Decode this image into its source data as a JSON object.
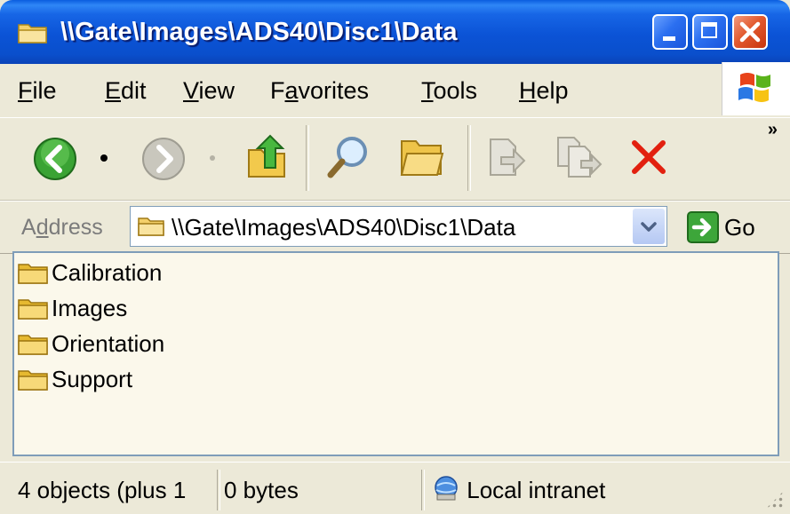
{
  "window": {
    "title": "\\\\Gate\\Images\\ADS40\\Disc1\\Data",
    "title_icon": "folder-icon"
  },
  "menu": {
    "items": [
      {
        "label": "File",
        "accel": "F",
        "rest": "ile"
      },
      {
        "label": "Edit",
        "accel": "E",
        "rest": "dit"
      },
      {
        "label": "View",
        "accel": "V",
        "rest": "iew"
      },
      {
        "label": "Favorites",
        "accel": "a",
        "pre": "F",
        "rest": "vorites"
      },
      {
        "label": "Tools",
        "accel": "T",
        "rest": "ools"
      },
      {
        "label": "Help",
        "accel": "H",
        "rest": "elp"
      }
    ]
  },
  "toolbar": {
    "buttons": [
      "back-icon",
      "forward-icon",
      "up-folder-icon",
      "search-icon",
      "folders-icon",
      "move-to-icon",
      "copy-to-icon",
      "delete-icon"
    ],
    "overflow": "»"
  },
  "address": {
    "label_pre": "A",
    "label_accel": "d",
    "label_rest": "dress",
    "value": "\\\\Gate\\Images\\ADS40\\Disc1\\Data",
    "go_label": "Go"
  },
  "files": [
    {
      "name": "Calibration",
      "icon": "folder-icon"
    },
    {
      "name": "Images",
      "icon": "folder-icon"
    },
    {
      "name": "Orientation",
      "icon": "folder-icon"
    },
    {
      "name": "Support",
      "icon": "folder-icon"
    }
  ],
  "status": {
    "objects": "4 objects (plus 1",
    "size": "0 bytes",
    "zone": "Local intranet",
    "zone_icon": "local-intranet-icon"
  },
  "colors": {
    "titlebar": "#0a53d6",
    "chrome": "#ece9d8",
    "list_background": "#fbf8eb",
    "close_button": "#e25a2f"
  }
}
